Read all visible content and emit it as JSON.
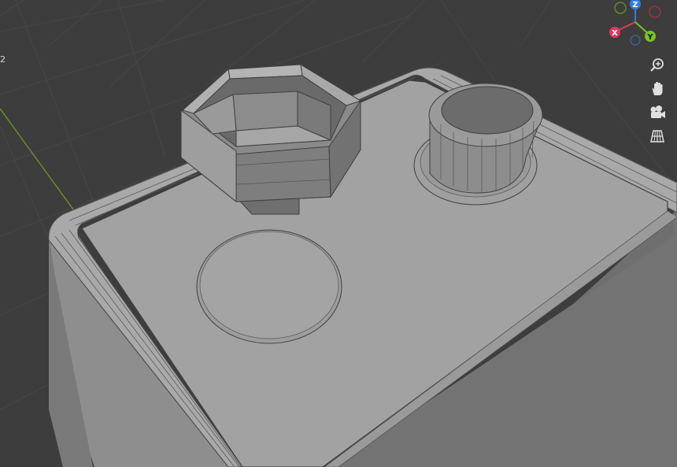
{
  "viewport": {
    "corner_text": "2"
  },
  "gizmo": {
    "axes": [
      {
        "label": "Z",
        "color": "#2f7ee0"
      },
      {
        "label": "X",
        "color": "#e0385a"
      },
      {
        "label": "Y",
        "color": "#7ac41e"
      }
    ],
    "negative_colors": {
      "x": "#a0303f",
      "y": "#5c8a2a",
      "z": "#3b5f94"
    }
  },
  "tools": [
    {
      "name": "zoom",
      "icon": "magnifier-plus-icon"
    },
    {
      "name": "pan",
      "icon": "hand-icon"
    },
    {
      "name": "camera",
      "icon": "camera-icon"
    },
    {
      "name": "perspective",
      "icon": "grid-perspective-icon"
    }
  ],
  "colors": {
    "background": "#3d3d3d",
    "grid_line": "#474747",
    "y_axis_line": "#6a8a2a",
    "mesh_light": "#a8a8a8",
    "mesh_mid": "#8c8c8c",
    "mesh_dark": "#6e6e6e",
    "wire": "#4a4a4a"
  }
}
